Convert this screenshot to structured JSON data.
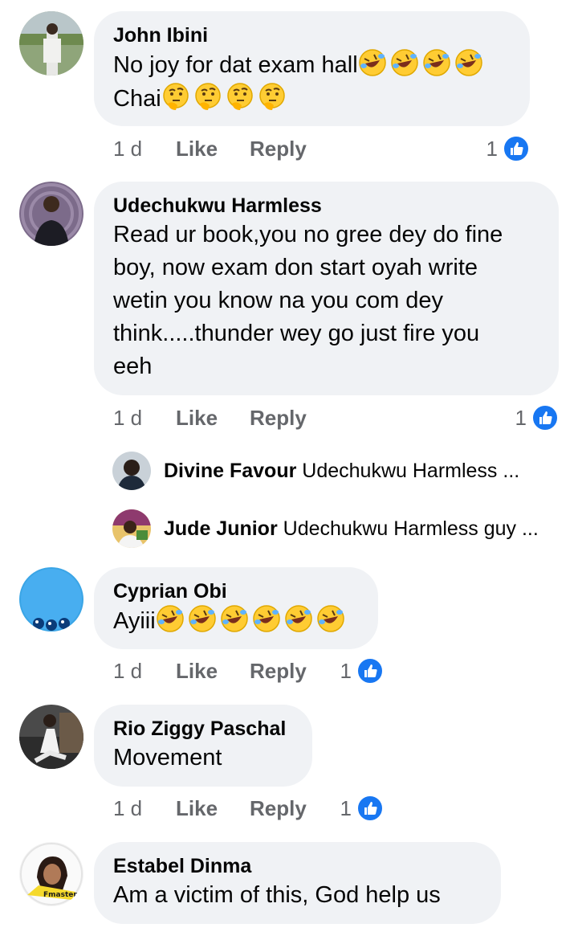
{
  "colors": {
    "bubble": "#f0f2f5",
    "meta": "#65676b",
    "like_blue": "#1877f2"
  },
  "actions": {
    "like": "Like",
    "reply": "Reply"
  },
  "comments": [
    {
      "author": "John Ibini",
      "line1": "No joy for dat exam hall",
      "line1_emoji": "rolling-on-floor-laughing x4",
      "line2": "Chai",
      "line2_emoji": "thinking-face x4",
      "time": "1 d",
      "reactions": "1"
    },
    {
      "author": "Udechukwu Harmless",
      "text": "Read ur book,you no gree dey do fine\nboy, now exam don start oyah write\nwetin you know na you com dey\nthink.....thunder wey go just fire you\neeh",
      "time": "1 d",
      "reactions": "1",
      "replies": [
        {
          "name": "Divine Favour",
          "text": "Udechukwu Harmless ..."
        },
        {
          "name": "Jude Junior",
          "text": "Udechukwu Harmless guy ..."
        }
      ]
    },
    {
      "author": "Cyprian Obi",
      "line1": "Ayiii",
      "line1_emoji": "rolling-on-floor-laughing x6",
      "time": "1 d",
      "reactions": "1"
    },
    {
      "author": "Rio Ziggy Paschal",
      "text": "Movement",
      "time": "1 d",
      "reactions": "1"
    },
    {
      "author": "Estabel Dinma",
      "text": "Am a victim of this, God help us",
      "avatar_sticker": "Fmaster"
    }
  ]
}
